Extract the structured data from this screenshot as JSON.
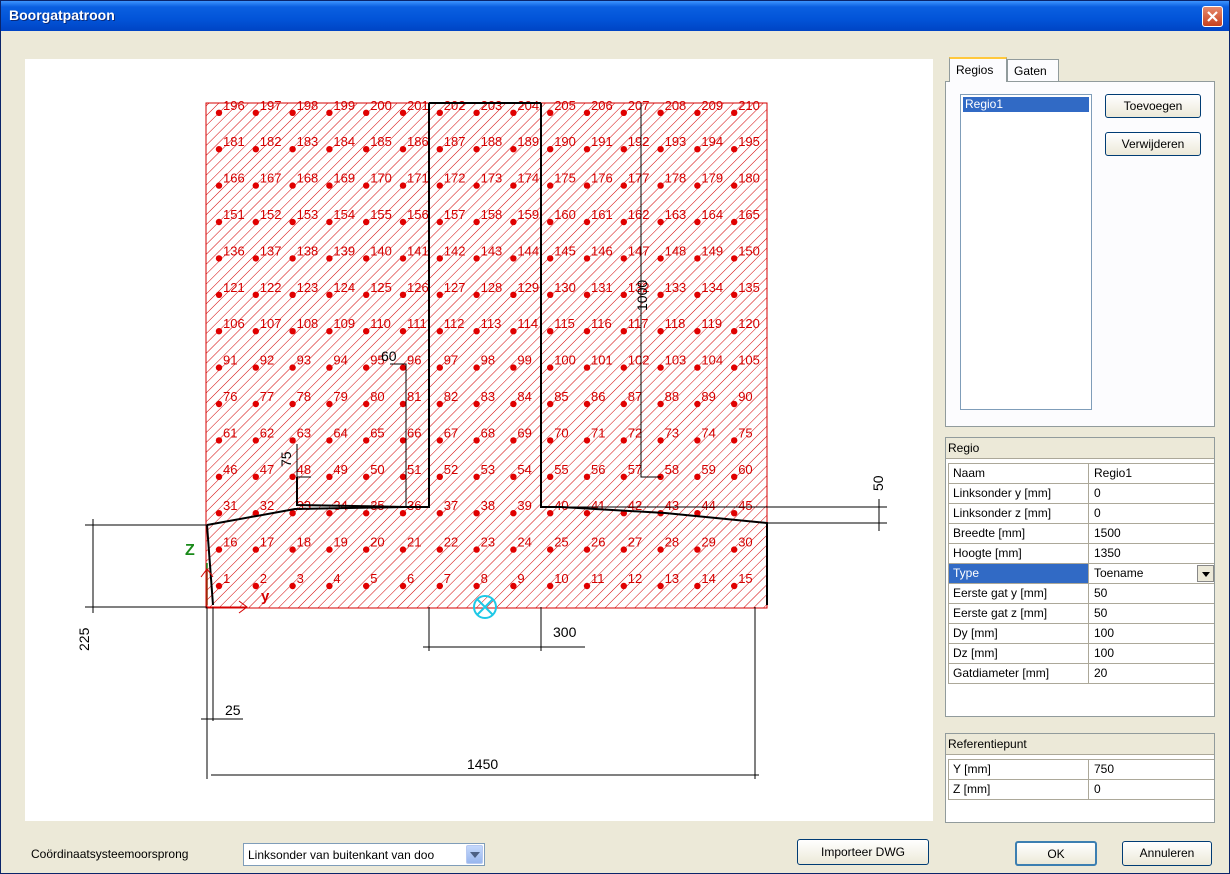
{
  "window": {
    "title": "Boorgatpatroon",
    "close_label": "✕"
  },
  "tabs": [
    {
      "label": "Regios",
      "active": true
    },
    {
      "label": "Gaten",
      "active": false
    }
  ],
  "regions_list": [
    "Regio1"
  ],
  "buttons": {
    "add": "Toevoegen",
    "remove": "Verwijderen",
    "import": "Importeer DWG",
    "ok": "OK",
    "cancel": "Annuleren"
  },
  "region_group": {
    "title": "Regio",
    "rows": [
      {
        "key": "Naam",
        "value": "Regio1"
      },
      {
        "key": "Linksonder y [mm]",
        "value": "0"
      },
      {
        "key": "Linksonder z [mm]",
        "value": "0"
      },
      {
        "key": "Breedte [mm]",
        "value": "1500"
      },
      {
        "key": "Hoogte [mm]",
        "value": "1350"
      },
      {
        "key": "Type",
        "value": "Toename",
        "selected": true,
        "dropdown": true
      },
      {
        "key": "Eerste gat y [mm]",
        "value": "50"
      },
      {
        "key": "Eerste gat z [mm]",
        "value": "50"
      },
      {
        "key": "Dy [mm]",
        "value": "100"
      },
      {
        "key": "Dz [mm]",
        "value": "100"
      },
      {
        "key": "Gatdiameter [mm]",
        "value": "20"
      }
    ]
  },
  "ref_group": {
    "title": "Referentiepunt",
    "rows": [
      {
        "key": "Y [mm]",
        "value": "750"
      },
      {
        "key": "Z [mm]",
        "value": "0"
      }
    ]
  },
  "origin": {
    "label": "Coördinaatsysteemoorsprong",
    "value": "Linksonder van buitenkant van doo"
  },
  "drawing": {
    "dimension_labels": {
      "d25": "25",
      "d225": "225",
      "d1450": "1450",
      "d300": "300",
      "d50": "50",
      "d1000": "1000",
      "d60": "60",
      "d75": "75"
    },
    "axis_labels": {
      "z": "Z",
      "y": "y"
    },
    "hole_grid": {
      "rows": 14,
      "columns": 15,
      "first_number": 1
    },
    "colors": {
      "region": "#d40000",
      "hole": "#e00000",
      "outline": "#000000",
      "ref_marker": "#1ec8e6",
      "axes": "#1a8a1a"
    }
  }
}
